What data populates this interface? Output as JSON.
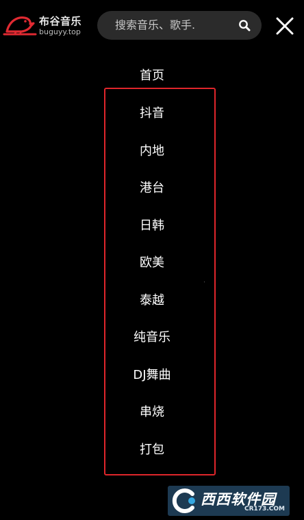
{
  "header": {
    "logo_title": "布谷音乐",
    "logo_domain": "buguyy.top",
    "search_placeholder": "搜索音乐、歌手.",
    "brand_color": "#e02a32"
  },
  "menu": {
    "home_label": "首页",
    "items": [
      {
        "label": "抖音"
      },
      {
        "label": "内地"
      },
      {
        "label": "港台"
      },
      {
        "label": "日韩"
      },
      {
        "label": "欧美"
      },
      {
        "label": "泰越"
      },
      {
        "label": "纯音乐"
      },
      {
        "label": "DJ舞曲"
      },
      {
        "label": "串烧"
      },
      {
        "label": "打包"
      }
    ],
    "highlight_color": "#e0262b"
  },
  "watermark": {
    "text": "西西软件园",
    "domain": "CR173.COM"
  },
  "icons": {
    "search": "search-icon",
    "close": "close-icon",
    "logo": "bird-logo-icon"
  }
}
